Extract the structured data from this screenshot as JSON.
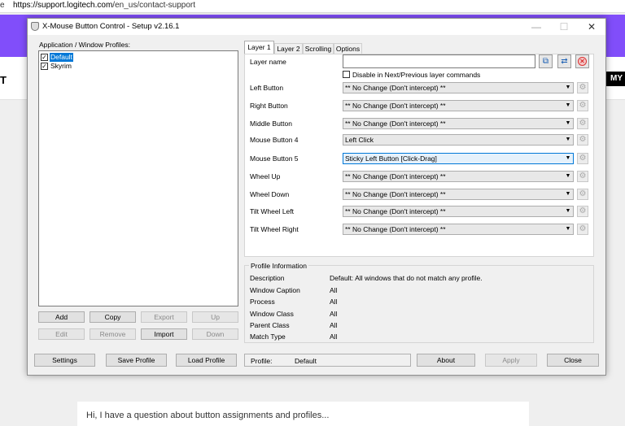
{
  "browser": {
    "left_fragment": "e",
    "url_host": "https://support.logitech.com",
    "url_path": "/en_us/contact-support"
  },
  "page": {
    "left_fragment": "T",
    "right_fragment": "MY",
    "question_text": "Hi, I have a question about button assignments and profiles..."
  },
  "window": {
    "title": "X-Mouse Button Control - Setup v2.16.1",
    "minimize": "—",
    "maximize": "☐",
    "close": "✕"
  },
  "profiles": {
    "header": "Application / Window Profiles:",
    "items": [
      {
        "label": "Default",
        "checked": true,
        "selected": true
      },
      {
        "label": "Skyrim",
        "checked": true,
        "selected": false
      }
    ],
    "buttons": {
      "add": "Add",
      "copy": "Copy",
      "export": "Export",
      "up": "Up",
      "edit": "Edit",
      "remove": "Remove",
      "import": "Import",
      "down": "Down"
    }
  },
  "tabs": [
    "Layer 1",
    "Layer 2",
    "Scrolling",
    "Options"
  ],
  "layer": {
    "name_label": "Layer name",
    "name_value": "",
    "disable_label": "Disable in Next/Previous layer commands",
    "disable_checked": false,
    "rows": [
      {
        "label": "Left Button",
        "value": "** No Change (Don't intercept) **"
      },
      {
        "label": "Right Button",
        "value": "** No Change (Don't intercept) **"
      },
      {
        "label": "Middle Button",
        "value": "** No Change (Don't intercept) **"
      },
      {
        "label": "Mouse Button 4",
        "value": "Left Click"
      },
      {
        "label": "Mouse Button 5",
        "value": "Sticky Left Button [Click-Drag]"
      },
      {
        "label": "Wheel Up",
        "value": "** No Change (Don't intercept) **"
      },
      {
        "label": "Wheel Down",
        "value": "** No Change (Don't intercept) **"
      },
      {
        "label": "Tilt Wheel Left",
        "value": "** No Change (Don't intercept) **"
      },
      {
        "label": "Tilt Wheel Right",
        "value": "** No Change (Don't intercept) **"
      }
    ]
  },
  "profile_info": {
    "title": "Profile Information",
    "rows": [
      {
        "label": "Description",
        "value": "Default: All windows that do not match any profile."
      },
      {
        "label": "Window Caption",
        "value": "All"
      },
      {
        "label": "Process",
        "value": "All"
      },
      {
        "label": "Window Class",
        "value": "All"
      },
      {
        "label": "Parent Class",
        "value": "All"
      },
      {
        "label": "Match Type",
        "value": "All"
      }
    ]
  },
  "footer": {
    "settings": "Settings",
    "save_profile": "Save Profile",
    "load_profile": "Load Profile",
    "profile_label": "Profile:",
    "profile_value": "Default",
    "about": "About",
    "apply": "Apply",
    "close": "Close"
  },
  "colors": {
    "accent_purple": "#814efa",
    "selection_blue": "#0078d7"
  }
}
